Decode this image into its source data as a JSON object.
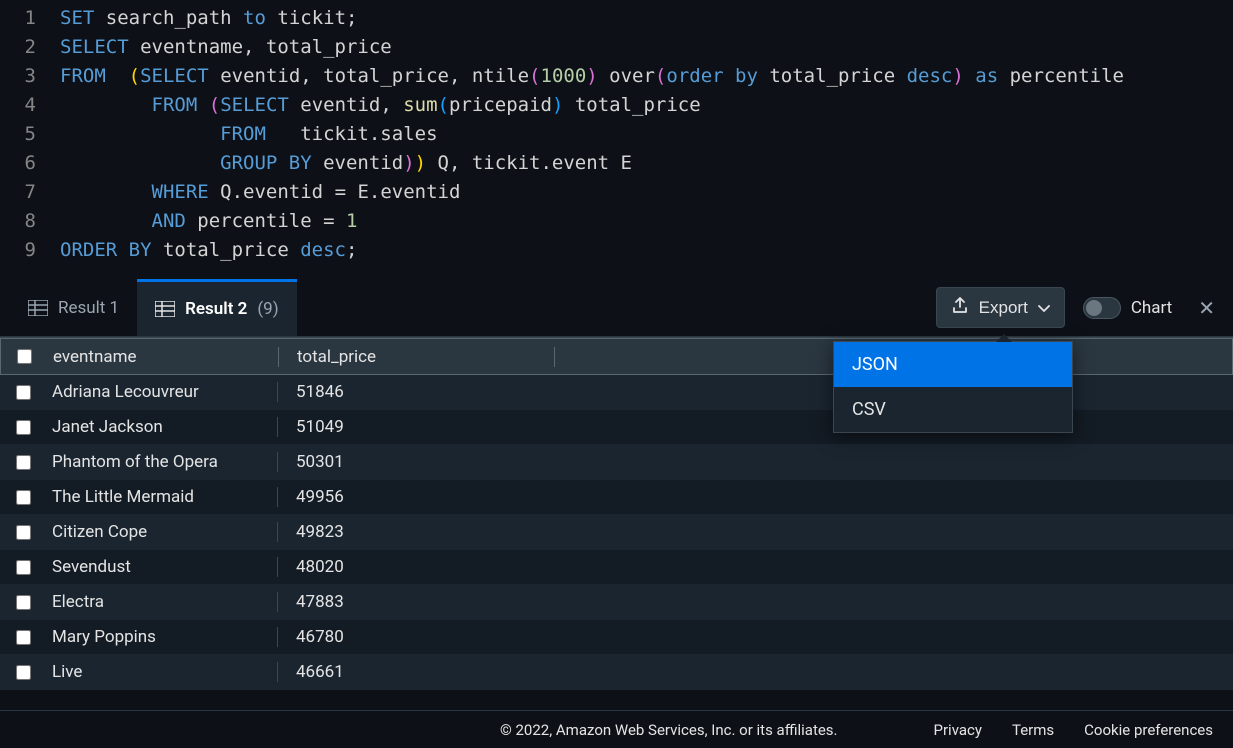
{
  "editor": {
    "lines": [
      {
        "n": 1,
        "tokens": [
          {
            "t": "SET",
            "c": "tok-keyword"
          },
          {
            "t": " search_path ",
            "c": "tok-plain"
          },
          {
            "t": "to",
            "c": "tok-keyword"
          },
          {
            "t": " tickit;",
            "c": "tok-plain"
          }
        ]
      },
      {
        "n": 2,
        "tokens": [
          {
            "t": "SELECT",
            "c": "tok-keyword"
          },
          {
            "t": " eventname, total_price",
            "c": "tok-plain"
          }
        ]
      },
      {
        "n": 3,
        "tokens": [
          {
            "t": "FROM",
            "c": "tok-keyword"
          },
          {
            "t": "  ",
            "c": "tok-plain"
          },
          {
            "t": "(",
            "c": "tok-paren"
          },
          {
            "t": "SELECT",
            "c": "tok-keyword"
          },
          {
            "t": " eventid, total_price, ntile",
            "c": "tok-plain"
          },
          {
            "t": "(",
            "c": "tok-paren2"
          },
          {
            "t": "1000",
            "c": "tok-num"
          },
          {
            "t": ")",
            "c": "tok-paren2"
          },
          {
            "t": " over",
            "c": "tok-plain"
          },
          {
            "t": "(",
            "c": "tok-paren2"
          },
          {
            "t": "order by",
            "c": "tok-keyword"
          },
          {
            "t": " total_price ",
            "c": "tok-plain"
          },
          {
            "t": "desc",
            "c": "tok-keyword"
          },
          {
            "t": ")",
            "c": "tok-paren2"
          },
          {
            "t": " ",
            "c": "tok-plain"
          },
          {
            "t": "as",
            "c": "tok-keyword"
          },
          {
            "t": " percentile",
            "c": "tok-plain"
          }
        ]
      },
      {
        "n": 4,
        "tokens": [
          {
            "t": "        ",
            "c": "tok-plain"
          },
          {
            "t": "FROM",
            "c": "tok-keyword"
          },
          {
            "t": " ",
            "c": "tok-plain"
          },
          {
            "t": "(",
            "c": "tok-paren2"
          },
          {
            "t": "SELECT",
            "c": "tok-keyword"
          },
          {
            "t": " eventid, ",
            "c": "tok-plain"
          },
          {
            "t": "sum",
            "c": "tok-func"
          },
          {
            "t": "(",
            "c": "tok-paren3"
          },
          {
            "t": "pricepaid",
            "c": "tok-plain"
          },
          {
            "t": ")",
            "c": "tok-paren3"
          },
          {
            "t": " total_price",
            "c": "tok-plain"
          }
        ]
      },
      {
        "n": 5,
        "tokens": [
          {
            "t": "              ",
            "c": "tok-plain"
          },
          {
            "t": "FROM",
            "c": "tok-keyword"
          },
          {
            "t": "   tickit.sales",
            "c": "tok-plain"
          }
        ]
      },
      {
        "n": 6,
        "tokens": [
          {
            "t": "              ",
            "c": "tok-plain"
          },
          {
            "t": "GROUP BY",
            "c": "tok-keyword"
          },
          {
            "t": " eventid",
            "c": "tok-plain"
          },
          {
            "t": ")",
            "c": "tok-paren2"
          },
          {
            "t": ")",
            "c": "tok-paren"
          },
          {
            "t": " Q, tickit.event E",
            "c": "tok-plain"
          }
        ]
      },
      {
        "n": 7,
        "tokens": [
          {
            "t": "        ",
            "c": "tok-plain"
          },
          {
            "t": "WHERE",
            "c": "tok-keyword"
          },
          {
            "t": " Q.eventid ",
            "c": "tok-plain"
          },
          {
            "t": "=",
            "c": "tok-plain"
          },
          {
            "t": " E.eventid",
            "c": "tok-plain"
          }
        ]
      },
      {
        "n": 8,
        "tokens": [
          {
            "t": "        ",
            "c": "tok-plain"
          },
          {
            "t": "AND",
            "c": "tok-keyword"
          },
          {
            "t": " percentile ",
            "c": "tok-plain"
          },
          {
            "t": "=",
            "c": "tok-plain"
          },
          {
            "t": " ",
            "c": "tok-plain"
          },
          {
            "t": "1",
            "c": "tok-num"
          }
        ]
      },
      {
        "n": 9,
        "tokens": [
          {
            "t": "ORDER BY",
            "c": "tok-keyword"
          },
          {
            "t": " total_price ",
            "c": "tok-plain"
          },
          {
            "t": "desc",
            "c": "tok-keyword"
          },
          {
            "t": ";",
            "c": "tok-plain"
          }
        ]
      }
    ]
  },
  "tabs": {
    "result1": "Result 1",
    "result2": "Result 2",
    "result2_count": "(9)"
  },
  "actions": {
    "export": "Export",
    "chart": "Chart",
    "menu": {
      "json": "JSON",
      "csv": "CSV"
    }
  },
  "table": {
    "columns": {
      "eventname": "eventname",
      "total_price": "total_price"
    },
    "rows": [
      {
        "eventname": "Adriana Lecouvreur",
        "total_price": "51846"
      },
      {
        "eventname": "Janet Jackson",
        "total_price": "51049"
      },
      {
        "eventname": "Phantom of the Opera",
        "total_price": "50301"
      },
      {
        "eventname": "The Little Mermaid",
        "total_price": "49956"
      },
      {
        "eventname": "Citizen Cope",
        "total_price": "49823"
      },
      {
        "eventname": "Sevendust",
        "total_price": "48020"
      },
      {
        "eventname": "Electra",
        "total_price": "47883"
      },
      {
        "eventname": "Mary Poppins",
        "total_price": "46780"
      },
      {
        "eventname": "Live",
        "total_price": "46661"
      }
    ]
  },
  "footer": {
    "copyright": "© 2022, Amazon Web Services, Inc. or its affiliates.",
    "privacy": "Privacy",
    "terms": "Terms",
    "cookies": "Cookie preferences"
  }
}
